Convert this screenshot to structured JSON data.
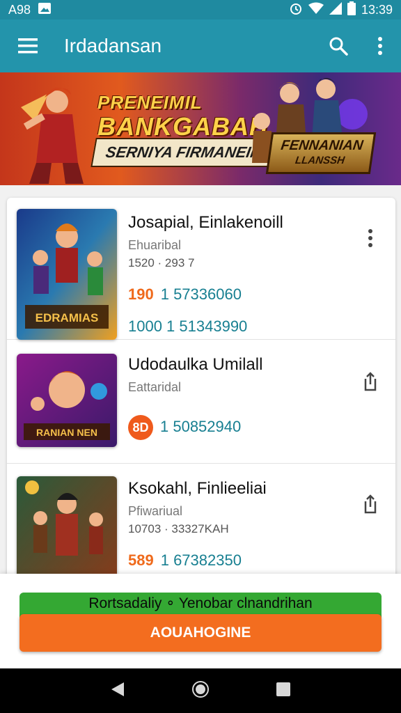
{
  "status_bar": {
    "left_text": "A98",
    "time": "13:39"
  },
  "app_bar": {
    "title": "Irdadansan"
  },
  "banner": {
    "title_line1": "PRENEIMIL",
    "title_line2": "BANKGABAH",
    "subtitle": "SERNIYA FIRMANEIN",
    "badge_line1": "FENNANIAN",
    "badge_line2": "LLANSSH"
  },
  "items": [
    {
      "title": "Josapial, Einlakenoill",
      "subtitle": "Ehuaribal",
      "meta": "1520 · 293 7",
      "price_accent": "190",
      "price": "1 57336060",
      "price2": "1000 1 51343990",
      "thumb_label": "EDRAMIAS",
      "action_icon": "more-vert-icon"
    },
    {
      "title": "Udodaulka Umilall",
      "subtitle": "Eattaridal",
      "badge": "8D",
      "price": "1 50852940",
      "thumb_label": "RANIAN NEN",
      "action_icon": "share-icon"
    },
    {
      "title": "Ksokahl, Finlieeliai",
      "subtitle": "Pfiwariual",
      "meta": "10703 · 33327KAH",
      "price_accent": "589",
      "price": "1 67382350",
      "action_icon": "share-icon"
    }
  ],
  "bottom_sheet": {
    "green_label": "Rortsadaliy ∘ Yenobar clnandrihan",
    "button_label": "AOUAHOGINE"
  },
  "colors": {
    "primary": "#2394ab",
    "accent": "#f36d1f",
    "green": "#34a833",
    "price": "#177f91"
  }
}
